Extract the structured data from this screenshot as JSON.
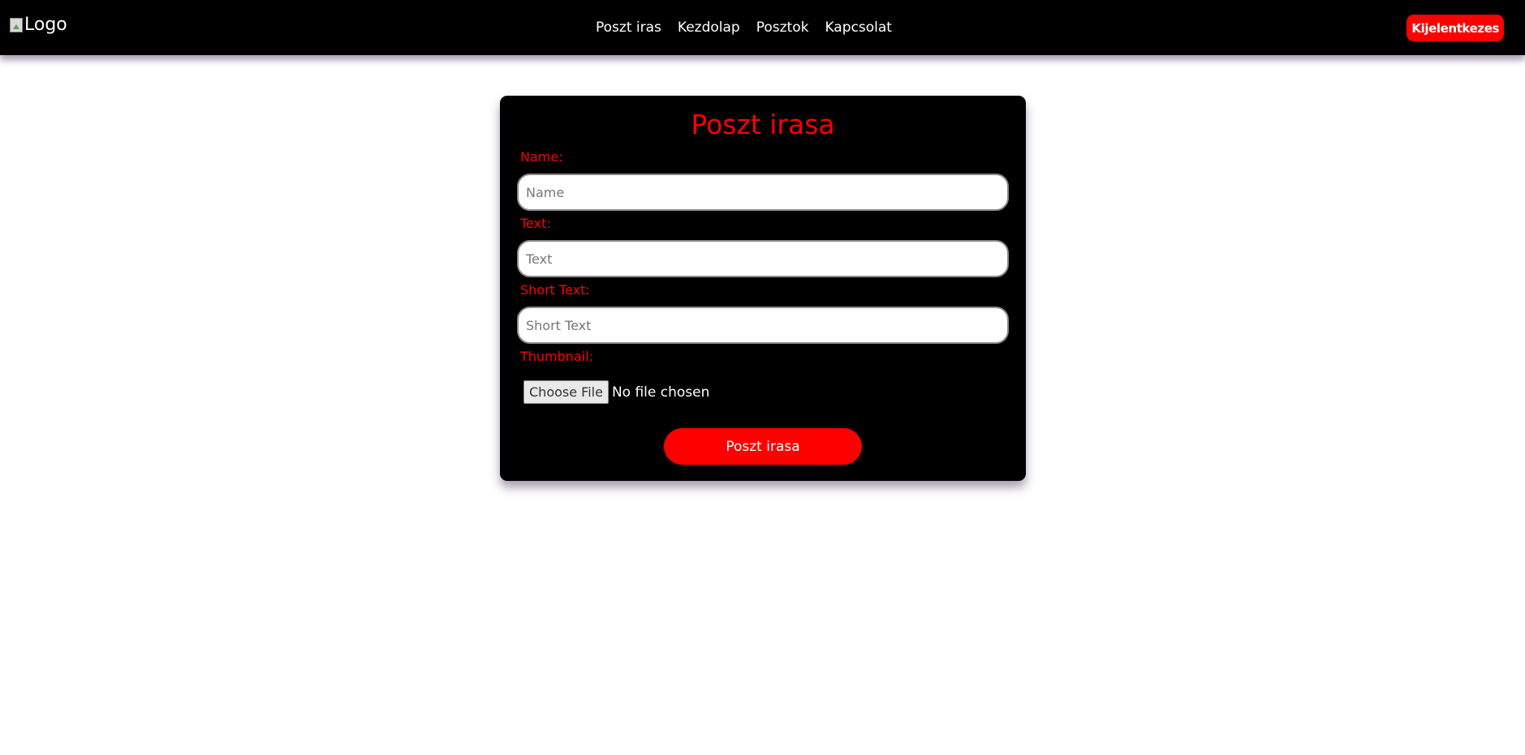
{
  "header": {
    "logo_alt": "Logo",
    "nav": [
      {
        "label": "Poszt iras"
      },
      {
        "label": "Kezdolap"
      },
      {
        "label": "Posztok"
      },
      {
        "label": "Kapcsolat"
      }
    ],
    "logout_label": "Kijelentkezes",
    "accent_color": "#ff0000",
    "background_color": "#000000"
  },
  "form": {
    "title": "Poszt irasa",
    "name": {
      "label": "Name:",
      "placeholder": "Name",
      "value": ""
    },
    "text": {
      "label": "Text:",
      "placeholder": "Text",
      "value": ""
    },
    "short_text": {
      "label": "Short Text:",
      "placeholder": "Short Text",
      "value": ""
    },
    "thumbnail": {
      "label": "Thumbnail:",
      "choose_file_label": "Choose File",
      "status": "No file chosen"
    },
    "submit_label": "Poszt irasa"
  }
}
